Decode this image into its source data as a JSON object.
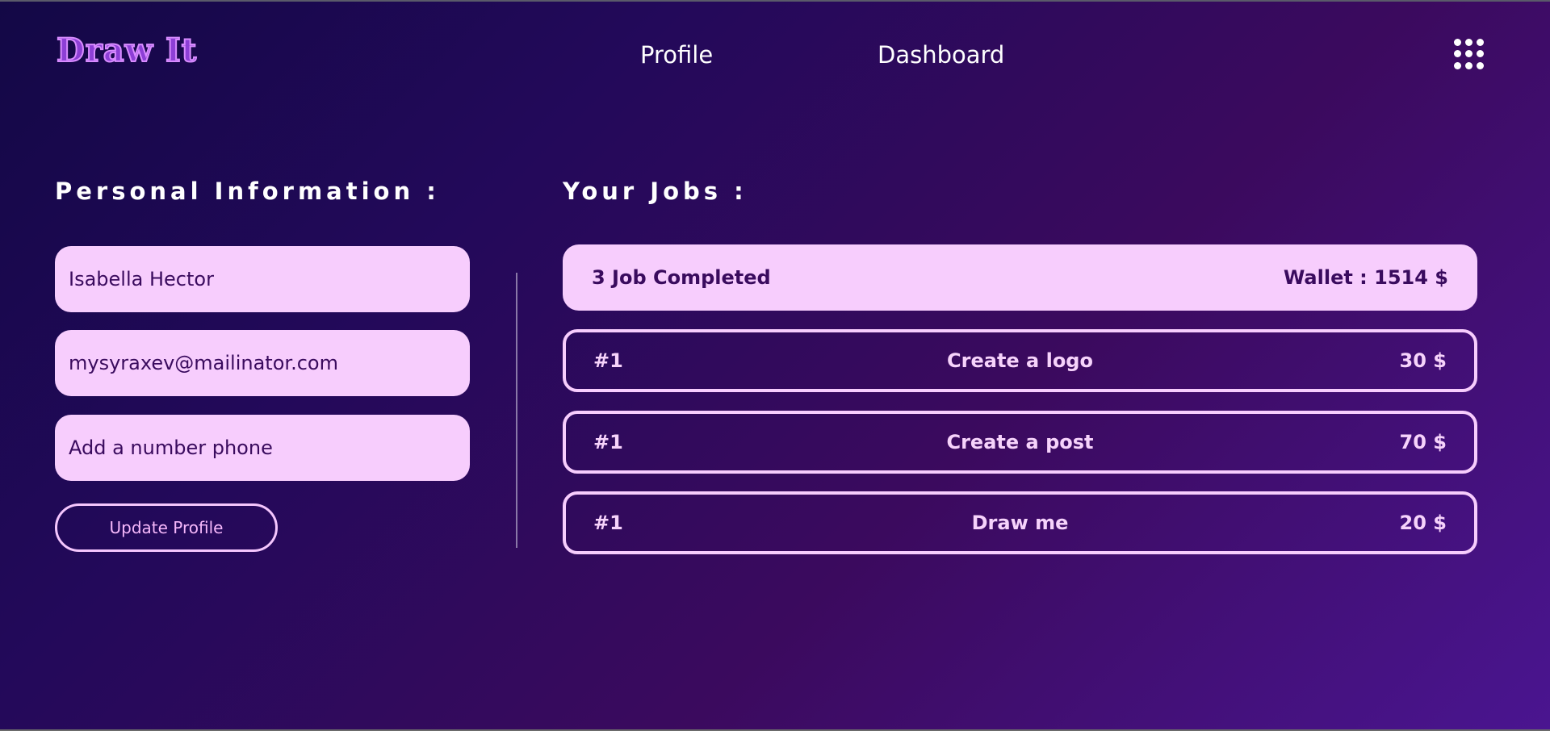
{
  "header": {
    "logo_text": "Draw It",
    "nav": {
      "profile": "Profile",
      "dashboard": "Dashboard"
    },
    "menu_icon": "apps-grid-icon"
  },
  "personal": {
    "title": "Personal Information :",
    "name_value": "Isabella Hector",
    "email_value": "mysyraxev@mailinator.com",
    "phone_placeholder": "Add a number phone",
    "update_button": "Update Profile"
  },
  "jobs": {
    "title": "Your Jobs :",
    "summary": {
      "completed": "3 Job Completed",
      "wallet_label": "Wallet :",
      "wallet_value": "1514 $"
    },
    "items": [
      {
        "index": "#1",
        "title": "Create a logo",
        "price": "30 $"
      },
      {
        "index": "#1",
        "title": "Create a post",
        "price": "70 $"
      },
      {
        "index": "#1",
        "title": "Draw me",
        "price": "20 $"
      }
    ]
  },
  "colors": {
    "field_background": "#f7cdfd",
    "field_text": "#3a0b5e",
    "accent_pink": "#f6b8fb",
    "logo_fill": "#8d3fd6"
  }
}
